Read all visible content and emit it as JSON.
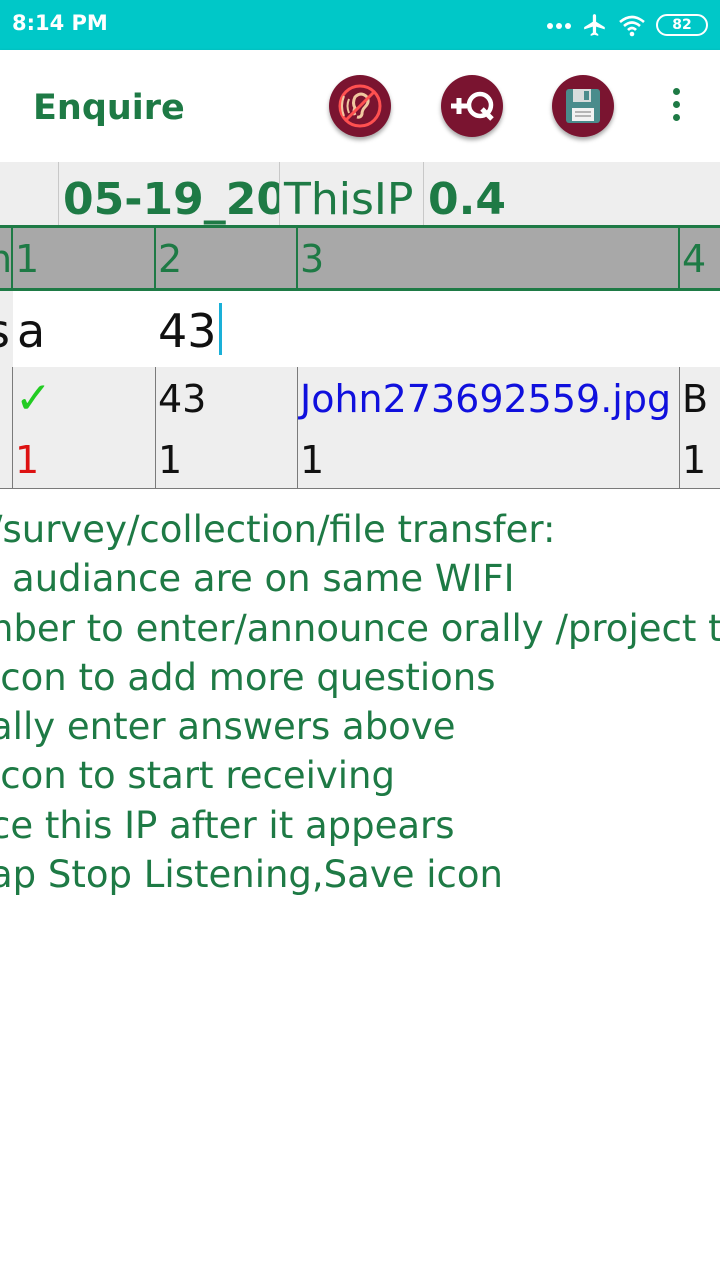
{
  "status_bar": {
    "time": "8:14 PM",
    "battery": "82",
    "color": "#00c8c8"
  },
  "app_bar": {
    "title": "Enquire",
    "actions": [
      {
        "name": "stop-listening",
        "icon": "ear-crossed-icon"
      },
      {
        "name": "add-question",
        "label": "+Q",
        "icon": "add-question-icon"
      },
      {
        "name": "save",
        "icon": "floppy-disk-icon"
      },
      {
        "name": "overflow-menu",
        "icon": "more-vert-icon"
      }
    ],
    "accent": "#1e7a45",
    "button_color": "#7a1430"
  },
  "grid": {
    "info_row": [
      "",
      "05-19_20",
      "ThisIP",
      "0.4"
    ],
    "header_row": [
      "n",
      "1",
      "2",
      "3",
      "4"
    ],
    "edit_row": [
      "s",
      "a",
      "43",
      "",
      ""
    ],
    "rows": [
      [
        "",
        "✓",
        "43",
        "John273692559.jpg",
        "B"
      ],
      [
        "",
        "1",
        "1",
        "1",
        "1"
      ]
    ],
    "colors": {
      "check": "#22cc22",
      "red_value": "#dd1111",
      "link": "#1010dd"
    }
  },
  "instructions": [
    "/survey/collection/file transfer:",
    "l audiance are on same WIFI",
    "nber to enter/announce orally /project to",
    "icon to add more questions",
    "ally enter answers above",
    "icon to start receiving",
    "ce this IP after it appears",
    "ap Stop Listening,Save icon"
  ]
}
